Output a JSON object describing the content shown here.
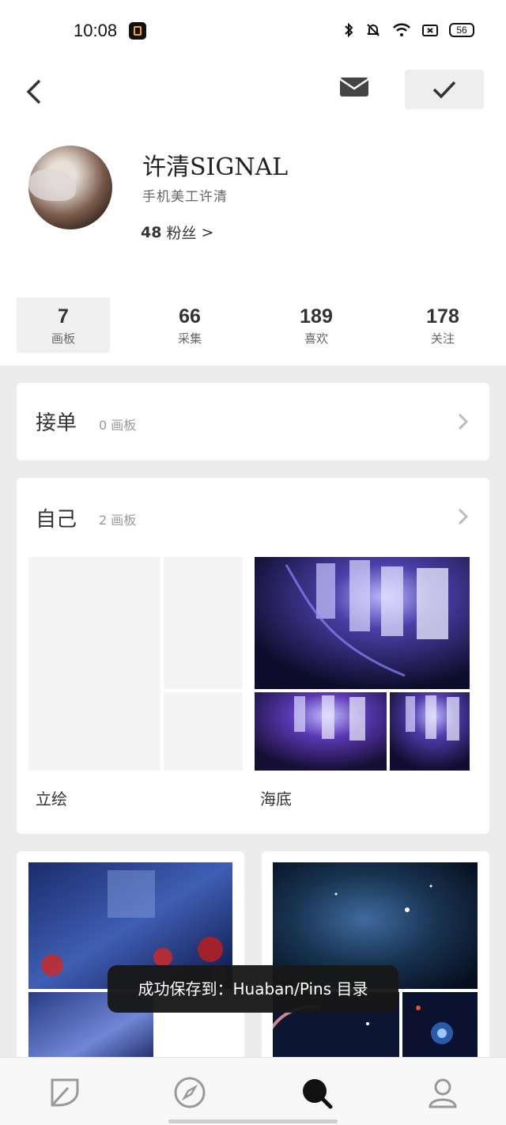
{
  "status_bar": {
    "time": "10:08",
    "battery": "56"
  },
  "profile": {
    "name": "许清SIGNAL",
    "bio": "手机美工许清",
    "fans_count": "48",
    "fans_label": "粉丝",
    "fans_chevron": ">"
  },
  "stats": [
    {
      "value": "7",
      "label": "画板"
    },
    {
      "value": "66",
      "label": "采集"
    },
    {
      "value": "189",
      "label": "喜欢"
    },
    {
      "value": "178",
      "label": "关注"
    }
  ],
  "boards_group_1": {
    "title": "接单",
    "count": "0 画板"
  },
  "boards_group_2": {
    "title": "自己",
    "count": "2 画板",
    "boards": [
      {
        "name": "立绘"
      },
      {
        "name": "海底"
      }
    ]
  },
  "toast": {
    "text": "成功保存到：Huaban/Pins 目录"
  },
  "colors": {
    "background": "#ececec",
    "card": "#ffffff",
    "toast": "#181818",
    "text": "#222222"
  }
}
